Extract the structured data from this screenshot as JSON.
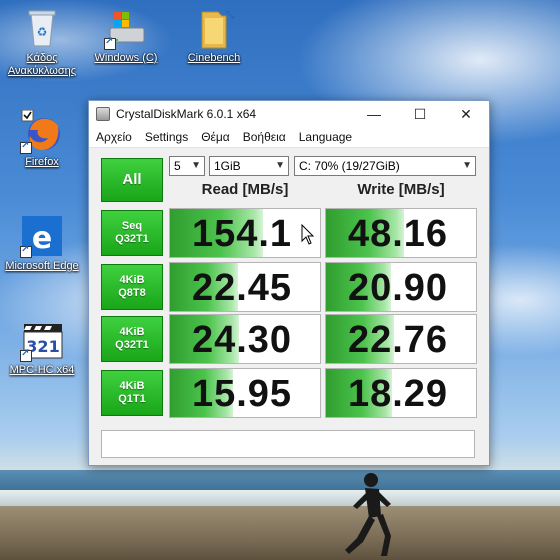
{
  "desktop": {
    "icons": [
      {
        "label": "Κάδος Ανακύκλωσης",
        "icon": "recycle-bin-icon"
      },
      {
        "label": "Windows (C)",
        "icon": "drive-icon"
      },
      {
        "label": "Cinebench",
        "icon": "folder-icon"
      },
      {
        "label": "Firefox",
        "icon": "firefox-icon"
      },
      {
        "label": "Microsoft Edge",
        "icon": "edge-icon"
      },
      {
        "label": "MPC-HC x64",
        "icon": "mpc-hc-icon"
      }
    ]
  },
  "window": {
    "title": "CrystalDiskMark 6.0.1 x64",
    "controls": {
      "minimize": "—",
      "maximize": "☐",
      "close": "✕"
    },
    "menu": [
      "Αρχείο",
      "Settings",
      "Θέμα",
      "Βοήθεια",
      "Language"
    ],
    "all_label": "All",
    "count": "5",
    "size": "1GiB",
    "drive": "C: 70% (19/27GiB)",
    "read_header": "Read [MB/s]",
    "write_header": "Write [MB/s]",
    "rows": [
      {
        "line1": "Seq",
        "line2": "Q32T1",
        "read": "154.1",
        "write": "48.16",
        "read_fill": 0.62,
        "write_fill": 0.52
      },
      {
        "line1": "4KiB",
        "line2": "Q8T8",
        "read": "22.45",
        "write": "20.90",
        "read_fill": 0.45,
        "write_fill": 0.43
      },
      {
        "line1": "4KiB",
        "line2": "Q32T1",
        "read": "24.30",
        "write": "22.76",
        "read_fill": 0.46,
        "write_fill": 0.45
      },
      {
        "line1": "4KiB",
        "line2": "Q1T1",
        "read": "15.95",
        "write": "18.29",
        "read_fill": 0.42,
        "write_fill": 0.44
      }
    ],
    "comment": ""
  },
  "colors": {
    "accent_green": "#19a619",
    "bar_green": "#4cc34c"
  }
}
